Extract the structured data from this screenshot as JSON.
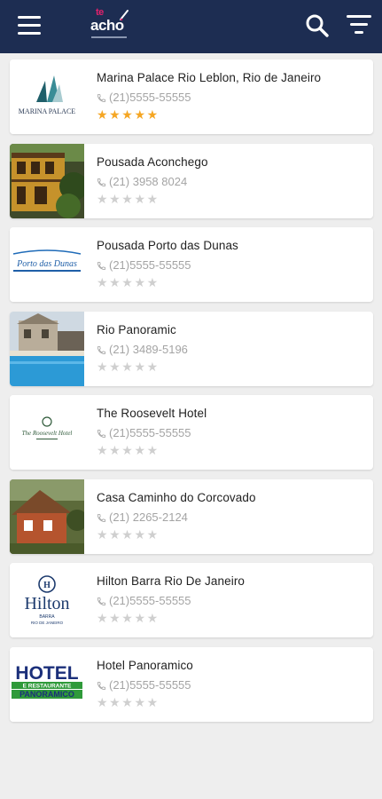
{
  "header": {
    "menu_icon": "hamburger-icon",
    "logo_top": "te",
    "logo_main": "acho",
    "search_icon": "search-icon",
    "filter_icon": "filter-icon",
    "brand_color": "#1d2d52",
    "accent_color": "#e2216c"
  },
  "hotels": [
    {
      "name": "Marina Palace Rio Leblon, Rio de Janeiro",
      "phone": "(21)5555-55555",
      "stars": "★★★★★",
      "rating": 5,
      "thumb_text": "MARINA PALACE"
    },
    {
      "name": "Pousada Aconchego",
      "phone": "(21) 3958 8024",
      "stars": "★★★★★",
      "rating": 0
    },
    {
      "name": "Pousada Porto das Dunas",
      "phone": "(21)5555-55555",
      "stars": "★★★★★",
      "rating": 0,
      "thumb_text": "Porto das Dunas"
    },
    {
      "name": "Rio Panoramic",
      "phone": "(21) 3489-5196",
      "stars": "★★★★★",
      "rating": 0
    },
    {
      "name": "The Roosevelt Hotel",
      "phone": "(21)5555-55555",
      "stars": "★★★★★",
      "rating": 0,
      "thumb_text": "The Roosevelt Hotel"
    },
    {
      "name": "Casa Caminho do Corcovado",
      "phone": "(21) 2265-2124",
      "stars": "★★★★★",
      "rating": 0
    },
    {
      "name": "Hilton Barra Rio De Janeiro",
      "phone": "(21)5555-55555",
      "stars": "★★★★★",
      "rating": 0,
      "thumb_text": "Hilton",
      "thumb_sub1": "BARRA",
      "thumb_sub2": "RIO DE JANEIRO"
    },
    {
      "name": "Hotel Panoramico",
      "phone": "(21)5555-55555",
      "stars": "★★★★★",
      "rating": 0,
      "thumb_text": "HOTEL",
      "thumb_sub1": "E RESTAURANTE",
      "thumb_sub2": "PANORAMICO"
    }
  ]
}
